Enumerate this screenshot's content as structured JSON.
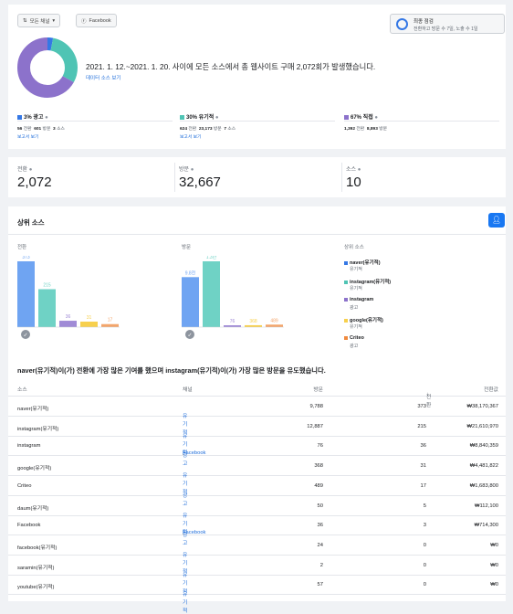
{
  "header": {
    "channel_dropdown": "모든 채널",
    "platform_filter": "Facebook",
    "last_check_title": "최종 점검",
    "last_check_desc": "전환하고 방문 수 7일, 노출 수 1일"
  },
  "summary": {
    "sentence": "2021. 1. 12.~2021. 1. 20. 사이에 모든 소스에서 총 웹사이트 구매 2,072회가 발생했습니다.",
    "link": "데이터 소스 보기",
    "donut": [
      {
        "label": "광고",
        "percent": 3,
        "color": "#3578e5"
      },
      {
        "label": "유기적",
        "percent": 30,
        "color": "#4fc4b4"
      },
      {
        "label": "직접",
        "percent": 67,
        "color": "#8c72cb"
      }
    ]
  },
  "breakdown": [
    {
      "title": "3% 광고",
      "color": "#3578e5",
      "conv": "56",
      "conv_label": "전환",
      "visits": "601",
      "visits_label": "방문",
      "src": "3",
      "src_label": "소스",
      "link": "보고서 보기"
    },
    {
      "title": "30% 유기적",
      "color": "#4fc4b4",
      "conv": "624",
      "conv_label": "전환",
      "visits": "23,173",
      "visits_label": "방문",
      "src": "7",
      "src_label": "소스",
      "link": "보고서 보기"
    },
    {
      "title": "67% 직접",
      "color": "#8c72cb",
      "conv": "1,392",
      "conv_label": "전환",
      "visits": "8,893",
      "visits_label": "방문",
      "src": "",
      "src_label": "",
      "link": ""
    }
  ],
  "metrics": [
    {
      "label": "전환",
      "value": "2,072"
    },
    {
      "label": "방문",
      "value": "32,667"
    },
    {
      "label": "소스",
      "value": "10"
    }
  ],
  "top_sources": {
    "title": "상위 소스",
    "conv_label": "전환",
    "visit_label": "방문",
    "legend_label": "상위 소스",
    "legend": [
      {
        "name": "naver(유기적)",
        "sub": "유기적",
        "color": "#3578e5"
      },
      {
        "name": "instagram(유기적)",
        "sub": "유기적",
        "color": "#4fc4b4"
      },
      {
        "name": "instagram",
        "sub": "광고",
        "color": "#8c72cb"
      },
      {
        "name": "google(유기적)",
        "sub": "유기적",
        "color": "#f7d04d"
      },
      {
        "name": "Criteo",
        "sub": "광고",
        "color": "#f08a3e"
      }
    ],
    "insight": "naver(유기적)이(가) 전환에 가장 많은 기여를 했으며 instagram(유기적)이(가) 가장 많은 방문을 유도했습니다."
  },
  "chart_data": [
    {
      "type": "bar",
      "title": "전환",
      "categories": [
        "naver(유기적)",
        "instagram(유기적)",
        "instagram",
        "google(유기적)",
        "Criteo"
      ],
      "values": [
        373,
        215,
        36,
        31,
        17
      ],
      "value_labels": [
        "373",
        "215",
        "36",
        "31",
        "17"
      ],
      "colors": [
        "#6fa4f2",
        "#6fd2c5",
        "#a08bd6",
        "#f7d04d",
        "#f3a56b"
      ],
      "ylim": [
        0,
        373
      ]
    },
    {
      "type": "bar",
      "title": "방문",
      "categories": [
        "naver(유기적)",
        "instagram(유기적)",
        "instagram",
        "google(유기적)",
        "Criteo"
      ],
      "values": [
        9800,
        12900,
        76,
        368,
        489
      ],
      "value_labels": [
        "9.8천",
        "1.3만",
        "76",
        "368",
        "489"
      ],
      "colors": [
        "#6fa4f2",
        "#6fd2c5",
        "#a08bd6",
        "#f7d04d",
        "#f3a56b"
      ],
      "ylim": [
        0,
        12900
      ]
    }
  ],
  "table": {
    "headers": [
      "소스",
      "채널",
      "방문",
      "전환",
      "전환값"
    ],
    "sort_arrow": "↓",
    "rows": [
      {
        "source": "naver(유기적)",
        "channel": "유기적",
        "channel2": "",
        "visits": "9,788",
        "conv": "373",
        "value": "₩38,170,367"
      },
      {
        "source": "instagram(유기적)",
        "channel": "유기적",
        "channel2": "",
        "visits": "12,887",
        "conv": "215",
        "value": "₩21,610,970"
      },
      {
        "source": "instagram",
        "channel": "광고",
        "channel2": "Facebook",
        "visits": "76",
        "conv": "36",
        "value": "₩8,840,359"
      },
      {
        "source": "google(유기적)",
        "channel": "유기적",
        "channel2": "",
        "visits": "368",
        "conv": "31",
        "value": "₩4,481,822"
      },
      {
        "source": "Criteo",
        "channel": "광고",
        "channel2": "",
        "visits": "489",
        "conv": "17",
        "value": "₩1,683,800"
      },
      {
        "source": "daum(유기적)",
        "channel": "유기적",
        "channel2": "",
        "visits": "50",
        "conv": "5",
        "value": "₩112,100"
      },
      {
        "source": "Facebook",
        "channel": "광고",
        "channel2": "Facebook",
        "visits": "36",
        "conv": "3",
        "value": "₩714,300"
      },
      {
        "source": "facebook(유기적)",
        "channel": "유기적",
        "channel2": "",
        "visits": "24",
        "conv": "0",
        "value": "₩0"
      },
      {
        "source": "saramin(유기적)",
        "channel": "유기적",
        "channel2": "",
        "visits": "2",
        "conv": "0",
        "value": "₩0"
      },
      {
        "source": "youtube(유기적)",
        "channel": "유기적",
        "channel2": "",
        "visits": "57",
        "conv": "0",
        "value": "₩0"
      }
    ]
  }
}
